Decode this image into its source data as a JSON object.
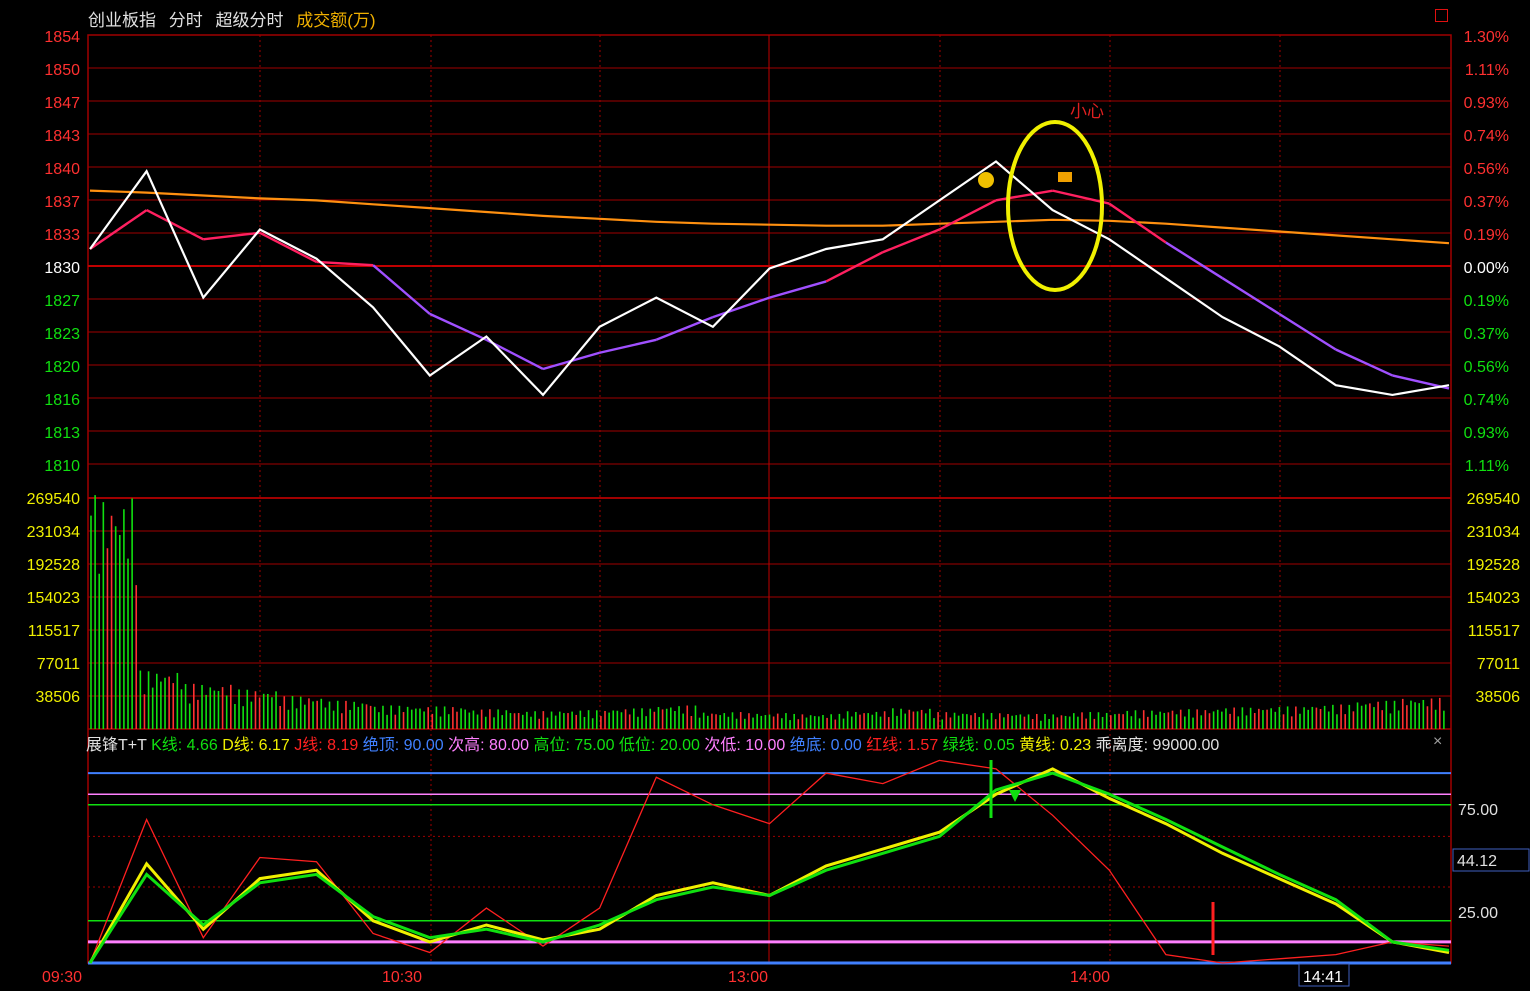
{
  "header": {
    "index_name": "创业板指",
    "tab_intraday": "分时",
    "tab_super_intraday": "超级分时",
    "overlay_label": "成交额(万)"
  },
  "price_panel": {
    "left_axis": [
      "1854",
      "1850",
      "1847",
      "1843",
      "1840",
      "1837",
      "1833",
      "1830",
      "1827",
      "1823",
      "1820",
      "1816",
      "1813",
      "1810"
    ],
    "right_axis": [
      "1.30%",
      "1.11%",
      "0.93%",
      "0.74%",
      "0.56%",
      "0.37%",
      "0.19%",
      "0.00%",
      "0.19%",
      "0.37%",
      "0.56%",
      "0.74%",
      "0.93%",
      "1.11%"
    ],
    "annotation": "小心"
  },
  "volume_panel": {
    "axis": [
      "269540",
      "231034",
      "192528",
      "154023",
      "115517",
      "77011",
      "38506"
    ]
  },
  "indicator": {
    "name": "展锋T+T",
    "items": [
      {
        "label": "K线",
        "value": "4.66",
        "color": "#10e010"
      },
      {
        "label": "D线",
        "value": "6.17",
        "color": "#f0f000"
      },
      {
        "label": "J线",
        "value": "8.19",
        "color": "#ff2020"
      },
      {
        "label": "绝顶",
        "value": "90.00",
        "color": "#4080ff"
      },
      {
        "label": "次高",
        "value": "80.00",
        "color": "#ff80ff"
      },
      {
        "label": "高位",
        "value": "75.00",
        "color": "#10e010"
      },
      {
        "label": "低位",
        "value": "20.00",
        "color": "#10e010"
      },
      {
        "label": "次低",
        "value": "10.00",
        "color": "#ff80ff"
      },
      {
        "label": "绝底",
        "value": "0.00",
        "color": "#4080ff"
      },
      {
        "label": "红线",
        "value": "1.57",
        "color": "#ff2020"
      },
      {
        "label": "绿线",
        "value": "0.05",
        "color": "#10e010"
      },
      {
        "label": "黄线",
        "value": "0.23",
        "color": "#f0f000"
      },
      {
        "label": "乖离度",
        "value": "99000.00",
        "color": "#e0e0e0"
      }
    ],
    "axis": [
      "75.00",
      "44.12",
      "25.00"
    ],
    "close": "×"
  },
  "time_axis": [
    "09:30",
    "10:30",
    "13:00",
    "14:00",
    "14:41"
  ],
  "colors": {
    "up": "#ff3030",
    "down": "#10e010",
    "grid": "#a00000",
    "price": "#ffffff",
    "avg": "#ff9010",
    "ma_up": "#ff2060",
    "ma_down": "#a050ff"
  },
  "chart_data": [
    {
      "type": "line",
      "title": "创业板指 分时",
      "x": [
        "09:30",
        "09:40",
        "09:50",
        "10:00",
        "10:10",
        "10:20",
        "10:30",
        "10:40",
        "10:50",
        "11:00",
        "11:10",
        "11:20",
        "11:30",
        "13:10",
        "13:20",
        "13:30",
        "13:40",
        "13:50",
        "14:00",
        "14:10",
        "14:20",
        "14:30",
        "14:40",
        "14:50",
        "15:00"
      ],
      "series": [
        {
          "name": "price",
          "values": [
            1832,
            1840,
            1827,
            1834,
            1831,
            1826,
            1819,
            1823,
            1817,
            1824,
            1827,
            1824,
            1830,
            1832,
            1833,
            1837,
            1841,
            1836,
            1833,
            1829,
            1825,
            1822,
            1818,
            1817,
            1818
          ]
        },
        {
          "name": "avg",
          "values": [
            1838,
            1837.8,
            1837.5,
            1837.2,
            1837,
            1836.6,
            1836.2,
            1835.8,
            1835.4,
            1835.1,
            1834.8,
            1834.6,
            1834.5,
            1834.4,
            1834.4,
            1834.6,
            1834.8,
            1835,
            1834.9,
            1834.6,
            1834.2,
            1833.8,
            1833.4,
            1833,
            1832.6
          ]
        }
      ],
      "ylim": [
        1810,
        1854
      ]
    },
    {
      "type": "bar",
      "title": "成交额(万)",
      "values": [
        249000,
        62000,
        48000,
        42000,
        35000,
        30000,
        25000,
        24000,
        21000,
        19000,
        20000,
        22000,
        25000,
        18000,
        17000,
        16000,
        19000,
        22000,
        18000,
        17000,
        16000,
        18000,
        20000,
        21000,
        23000,
        24000,
        26000,
        30000,
        33000
      ],
      "ylim": [
        0,
        269540
      ]
    },
    {
      "type": "line",
      "title": "展锋T+T",
      "x": [
        "09:30",
        "09:40",
        "09:50",
        "10:00",
        "10:10",
        "10:20",
        "10:30",
        "10:40",
        "10:50",
        "11:00",
        "11:10",
        "11:20",
        "11:30",
        "13:10",
        "13:20",
        "13:30",
        "13:40",
        "13:50",
        "14:00",
        "14:10",
        "14:20",
        "14:30",
        "14:40",
        "14:50",
        "15:00"
      ],
      "series": [
        {
          "name": "K",
          "values": [
            0,
            42,
            18,
            38,
            42,
            22,
            12,
            16,
            10,
            18,
            30,
            36,
            32,
            44,
            52,
            60,
            82,
            90,
            80,
            68,
            55,
            42,
            30,
            10,
            6
          ]
        },
        {
          "name": "D",
          "values": [
            0,
            47,
            16,
            40,
            44,
            20,
            10,
            18,
            11,
            16,
            32,
            38,
            32,
            46,
            54,
            62,
            80,
            92,
            78,
            66,
            52,
            40,
            28,
            10,
            5
          ]
        },
        {
          "name": "J",
          "values": [
            0,
            68,
            12,
            50,
            48,
            14,
            5,
            26,
            8,
            26,
            88,
            75,
            66,
            90,
            85,
            96,
            92,
            70,
            44,
            4,
            0,
            2,
            4,
            10,
            8
          ]
        }
      ],
      "ylim": [
        0,
        100
      ]
    }
  ]
}
